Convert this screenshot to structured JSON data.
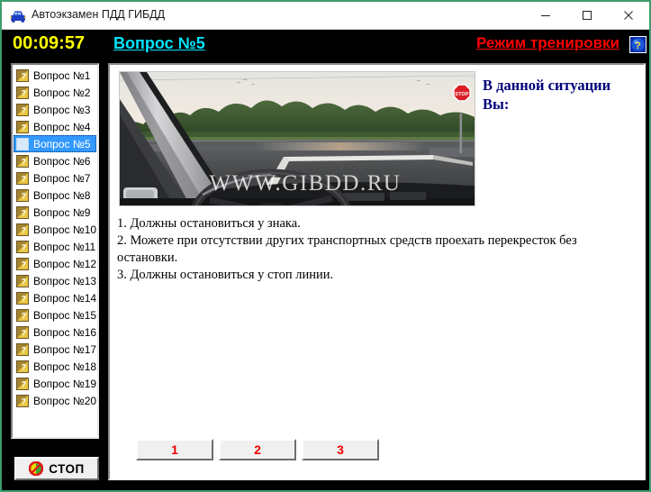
{
  "window": {
    "title": "Автоэкзамен ПДД ГИБДД",
    "icon": "car-icon",
    "minimize_label": "─",
    "maximize_label": "□",
    "close_label": "✕",
    "border_color": "#3f9c6d"
  },
  "status_bar": {
    "timer": "00:09:57",
    "timer_color": "#ffff00",
    "question_link": "Вопрос №5",
    "question_link_color": "#00e5ff",
    "mode": "Режим тренировки",
    "mode_color": "#ff0000",
    "help_icon": "help-question-icon",
    "background": "#000000"
  },
  "sidebar": {
    "selected_index": 4,
    "selected_bg": "#3399ff",
    "items": [
      {
        "label": "Вопрос №1",
        "icon": "question-mark-icon"
      },
      {
        "label": "Вопрос №2",
        "icon": "question-mark-icon"
      },
      {
        "label": "Вопрос №3",
        "icon": "question-mark-icon"
      },
      {
        "label": "Вопрос №4",
        "icon": "question-mark-icon"
      },
      {
        "label": "Вопрос №5",
        "icon": "question-mark-icon"
      },
      {
        "label": "Вопрос №6",
        "icon": "question-mark-icon"
      },
      {
        "label": "Вопрос №7",
        "icon": "question-mark-icon"
      },
      {
        "label": "Вопрос №8",
        "icon": "question-mark-icon"
      },
      {
        "label": "Вопрос №9",
        "icon": "question-mark-icon"
      },
      {
        "label": "Вопрос №10",
        "icon": "question-mark-icon"
      },
      {
        "label": "Вопрос №11",
        "icon": "question-mark-icon"
      },
      {
        "label": "Вопрос №12",
        "icon": "question-mark-icon"
      },
      {
        "label": "Вопрос №13",
        "icon": "question-mark-icon"
      },
      {
        "label": "Вопрос №14",
        "icon": "question-mark-icon"
      },
      {
        "label": "Вопрос №15",
        "icon": "question-mark-icon"
      },
      {
        "label": "Вопрос №16",
        "icon": "question-mark-icon"
      },
      {
        "label": "Вопрос №17",
        "icon": "question-mark-icon"
      },
      {
        "label": "Вопрос №18",
        "icon": "question-mark-icon"
      },
      {
        "label": "Вопрос №19",
        "icon": "question-mark-icon"
      },
      {
        "label": "Вопрос №20",
        "icon": "question-mark-icon"
      }
    ]
  },
  "stop_button": {
    "label": "СТОП",
    "icon": "no-entry-icon"
  },
  "main": {
    "prompt": "В данной ситуации Вы:",
    "prompt_color": "#00007c",
    "image": {
      "alt": "Вид из кабины автомобиля на перекресток со знаком СТОП",
      "watermark": "WWW.GIBDD.RU",
      "sign_text": "STOP"
    },
    "answers": [
      "1. Должны остановиться у знака.",
      "2. Можете при отсутствии других транспортных средств проехать перекресток без остановки.",
      "3. Должны остановиться у стоп линии."
    ],
    "answer_buttons": [
      {
        "label": "1"
      },
      {
        "label": "2"
      },
      {
        "label": "3"
      }
    ],
    "answer_button_color": "#ee0000"
  }
}
